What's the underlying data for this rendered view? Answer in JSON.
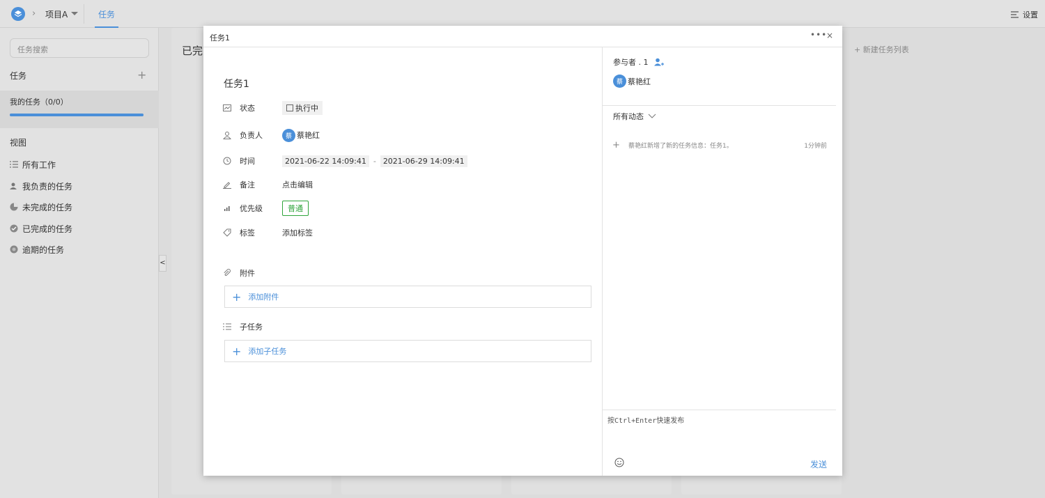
{
  "topbar": {
    "project_name": "项目A",
    "active_tab": "任务",
    "settings_label": "设置"
  },
  "sidebar": {
    "search_placeholder": "任务搜索",
    "task_section_title": "任务",
    "my_tasks_label": "我的任务（0/0）",
    "my_tasks_progress": 1.0,
    "views_title": "视图",
    "views": [
      {
        "label": "所有工作",
        "icon": "list-icon"
      },
      {
        "label": "我负责的任务",
        "icon": "user-task-icon"
      },
      {
        "label": "未完成的任务",
        "icon": "half-circle-icon"
      },
      {
        "label": "已完成的任务",
        "icon": "check-circle-icon"
      },
      {
        "label": "逾期的任务",
        "icon": "overdue-circle-icon"
      }
    ],
    "collapse_label": "<"
  },
  "board": {
    "first_column_title": "已完",
    "new_list_label": "+ 新建任务列表"
  },
  "modal": {
    "title": "任务1",
    "more_label": "•••",
    "close_label": "×",
    "task_name": "任务1",
    "fields": {
      "status": {
        "label": "状态",
        "value": "执行中"
      },
      "assignee": {
        "label": "负责人",
        "avatar": "蔡",
        "value": "蔡艳红"
      },
      "time": {
        "label": "时间",
        "start": "2021-06-22 14:09:41",
        "separator": "-",
        "end": "2021-06-29 14:09:41"
      },
      "note": {
        "label": "备注",
        "value": "点击编辑"
      },
      "priority": {
        "label": "优先级",
        "value": "普通",
        "color": "#2fa43b"
      },
      "tags": {
        "label": "标签",
        "value": "添加标签"
      }
    },
    "attachments": {
      "title": "附件",
      "add_label": "添加附件"
    },
    "subtasks": {
      "title": "子任务",
      "add_label": "添加子任务"
    },
    "right_panel": {
      "participants_label": "参与者 . 1",
      "participant_avatar": "蔡",
      "participant_name": "蔡艳红",
      "activity_filter": "所有动态",
      "activity_text": "蔡艳红新增了新的任务信息：任务1。",
      "activity_time": "1分钟前",
      "comment_placeholder": "按Ctrl+Enter快速发布",
      "send_label": "发送"
    }
  },
  "colors": {
    "accent": "#4a8fd9",
    "priority_green": "#2fa43b",
    "background": "#dcdcdc"
  }
}
